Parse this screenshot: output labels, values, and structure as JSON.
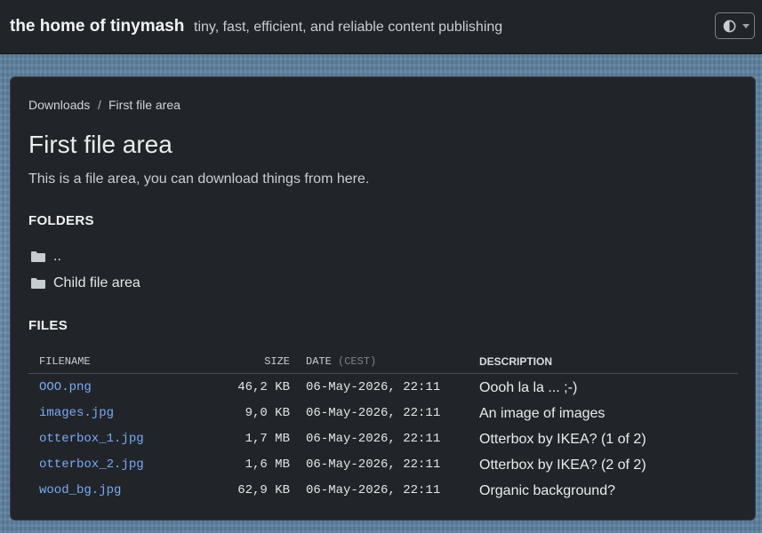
{
  "header": {
    "site_title": "the home of tinymash",
    "tagline": "tiny, fast, efficient, and reliable content publishing",
    "theme_toggle_icon": "contrast-icon"
  },
  "breadcrumb": {
    "root": "Downloads",
    "separator": "/",
    "current": "First file area"
  },
  "page": {
    "title": "First file area",
    "description": "This is a file area, you can download things from here."
  },
  "folders": {
    "heading": "FOLDERS",
    "items": [
      {
        "label": "..",
        "icon": "folder-icon"
      },
      {
        "label": "Child file area",
        "icon": "folder-icon"
      }
    ]
  },
  "files": {
    "heading": "FILES",
    "columns": {
      "filename": "FILENAME",
      "size": "SIZE",
      "date": "DATE",
      "timezone": "(CEST)",
      "description": "DESCRIPTION"
    },
    "rows": [
      {
        "filename": "OOO.png",
        "size": "46,2 KB",
        "date": "06-May-2026, 22:11",
        "description": "Oooh la la ... ;-)"
      },
      {
        "filename": "images.jpg",
        "size": "9,0 KB",
        "date": "06-May-2026, 22:11",
        "description": "An image of images"
      },
      {
        "filename": "otterbox_1.jpg",
        "size": "1,7 MB",
        "date": "06-May-2026, 22:11",
        "description": "Otterbox by IKEA? (1 of 2)"
      },
      {
        "filename": "otterbox_2.jpg",
        "size": "1,6 MB",
        "date": "06-May-2026, 22:11",
        "description": "Otterbox by IKEA? (2 of 2)"
      },
      {
        "filename": "wood_bg.jpg",
        "size": "62,9 KB",
        "date": "06-May-2026, 22:11",
        "description": "Organic background?"
      }
    ]
  },
  "colors": {
    "link": "#7aa9f5",
    "panel_bg": "#212529",
    "topbar_bg": "#212529"
  }
}
